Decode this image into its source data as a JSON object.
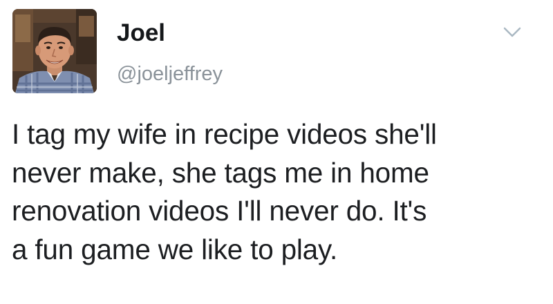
{
  "tweet": {
    "display_name": "Joel",
    "username": "@joeljeffrey",
    "text": "I tag my wife in recipe videos she'll\nnever make, she tags me in home\nrenovation videos I'll never do. It's\na fun game we like to play."
  },
  "icons": {
    "avatar": "profile-photo",
    "menu": "chevron-down-icon"
  },
  "colors": {
    "name": "#14171a",
    "username": "#8a9299",
    "text": "#1c1e21",
    "chevron": "#aab8c2"
  }
}
